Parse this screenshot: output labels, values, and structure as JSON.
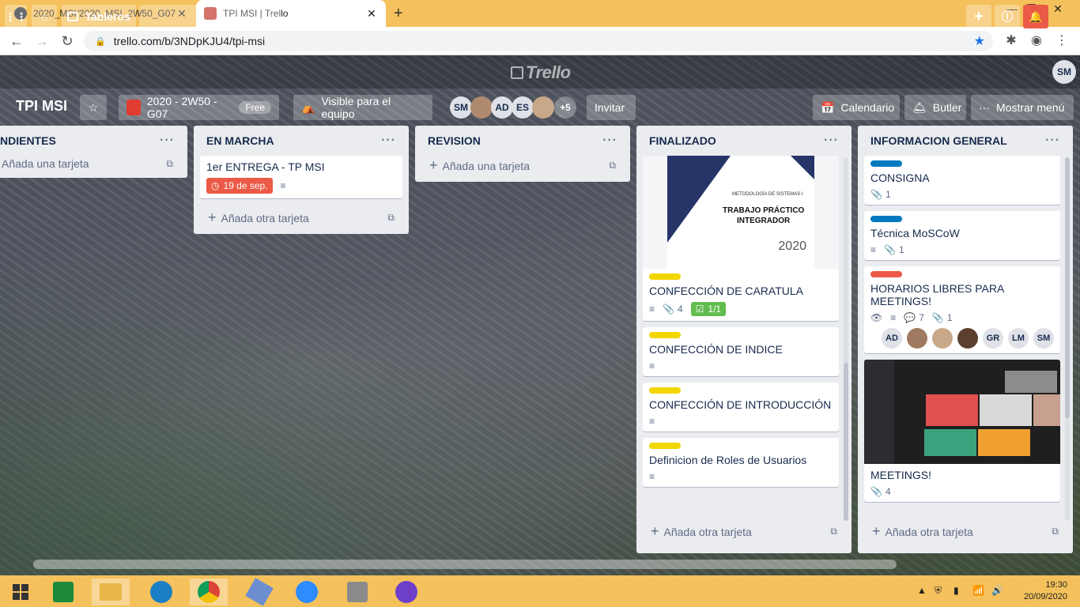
{
  "browser": {
    "tabs": [
      {
        "title": "2020_MSI/2020_MSI_2W50_G07_",
        "active": false
      },
      {
        "title": "TPI MSI | Trello",
        "active": true
      }
    ],
    "close_glyph": "✕",
    "new_tab_glyph": "+",
    "url": "trello.com/b/3NDpKJU4/tpi-msi",
    "window_controls": [
      "—",
      "❐",
      "✕"
    ]
  },
  "trello_header": {
    "boards_label": "Tableros",
    "logo_text": "Trello",
    "user_initials": "SM"
  },
  "board": {
    "title": "TPI MSI",
    "team_name": "2020 - 2W50 - G07",
    "team_badge": "Free",
    "visibility": "Visible para el equipo",
    "members": [
      "SM",
      "",
      "AD",
      "ES",
      ""
    ],
    "more_members": "+5",
    "invite_label": "Invitar",
    "calendar_label": "Calendario",
    "butler_label": "Butler",
    "menu_label": "Mostrar menú"
  },
  "lists": {
    "pendientes": {
      "title": "NDIENTES",
      "add_label": "Añada una tarjeta"
    },
    "en_marcha": {
      "title": "EN MARCHA",
      "card_title": "1er ENTREGA - TP MSI",
      "due": "19 de sep.",
      "add_label": "Añada otra tarjeta"
    },
    "revision": {
      "title": "REVISION",
      "add_label": "Añada una tarjeta"
    },
    "finalizado": {
      "title": "FINALIZADO",
      "cover": {
        "subject": "METODOLOGÍA DE SISTEMAS I",
        "title_line1": "TRABAJO PRÁCTICO",
        "title_line2": "INTEGRADOR",
        "year": "2020"
      },
      "cards": [
        {
          "title": "CONFECCIÓN DE CARATULA",
          "attachments": "4",
          "checklist": "1/1"
        },
        {
          "title": "CONFECCIÓN DE INDICE"
        },
        {
          "title": "CONFECCIÓN DE INTRODUCCIÓN"
        },
        {
          "title": "Definicion de Roles de Usuarios"
        }
      ],
      "add_label": "Añada otra tarjeta"
    },
    "informacion": {
      "title": "INFORMACION GENERAL",
      "cards": [
        {
          "title": "CONSIGNA",
          "attachments": "1"
        },
        {
          "title": "Técnica MoSCoW",
          "attachments": "1"
        },
        {
          "title": "HORARIOS LIBRES PARA MEETINGS!",
          "comments": "7",
          "attachments": "1",
          "members": [
            "AD",
            "",
            "",
            "",
            "GR",
            "LM",
            "SM"
          ]
        },
        {
          "title": "MEETINGS!",
          "attachments": "4"
        }
      ],
      "add_label": "Añada otra tarjeta"
    }
  },
  "colors": {
    "label_blue": "#0079bf",
    "label_red": "#eb5a46",
    "label_yellow": "#f2d600",
    "due_red": "#eb5a46",
    "checklist_green": "#61bd4f",
    "chrome_yellow": "#f5c15c"
  },
  "taskbar": {
    "icons": [
      "windows-start-icon",
      "excel-icon",
      "file-explorer-icon",
      "edge-icon",
      "chrome-icon",
      "virtualbox-icon",
      "zoom-icon",
      "tools-icon",
      "github-desktop-icon"
    ],
    "time": "19:30",
    "date": "20/09/2020"
  }
}
